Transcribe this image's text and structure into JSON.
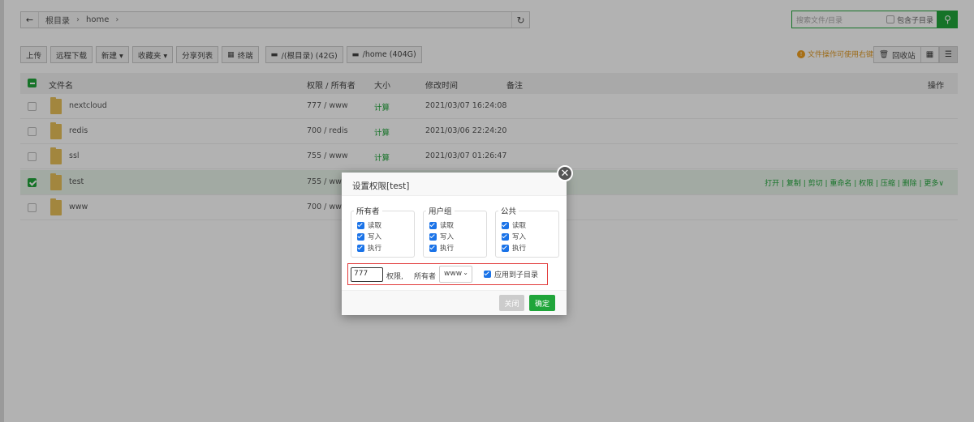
{
  "pathbar": {
    "back_icon": "arrow-left-icon",
    "crumbs": [
      "根目录",
      "home"
    ],
    "separator": "›",
    "refresh_icon": "refresh-icon"
  },
  "search": {
    "placeholder": "搜索文件/目录",
    "include_subdir_label": "包含子目录",
    "search_icon": "search-icon"
  },
  "toolbar": {
    "buttons": [
      "上传",
      "远程下载",
      "新建 ▾",
      "收藏夹 ▾",
      "分享列表",
      "终端"
    ],
    "disks": [
      "/(根目录) (42G)",
      "/home (404G)"
    ],
    "tip": "文件操作可使用右键",
    "recycle_label": "回收站"
  },
  "table": {
    "headers": {
      "name": "文件名",
      "perm": "权限 / 所有者",
      "size": "大小",
      "mtime": "修改时间",
      "note": "备注",
      "ops": "操作"
    },
    "rows": [
      {
        "name": "nextcloud",
        "perm": "777 / www",
        "size": "计算",
        "mtime": "2021/03/07 16:24:08",
        "selected": false
      },
      {
        "name": "redis",
        "perm": "700 / redis",
        "size": "计算",
        "mtime": "2021/03/06 22:24:20",
        "selected": false
      },
      {
        "name": "ssl",
        "perm": "755 / www",
        "size": "计算",
        "mtime": "2021/03/07 01:26:47",
        "selected": false
      },
      {
        "name": "test",
        "perm": "755 / www",
        "size": "",
        "mtime": "",
        "selected": true,
        "ops": "打开 | 复制 | 剪切 | 重命名 | 权限 | 压缩 | 删除 | 更多∨"
      },
      {
        "name": "www",
        "perm": "700 / www",
        "size": "",
        "mtime": "",
        "selected": false
      }
    ]
  },
  "modal": {
    "title": "设置权限[test]",
    "groups": [
      {
        "title": "所有者",
        "items": [
          "读取",
          "写入",
          "执行"
        ]
      },
      {
        "title": "用户组",
        "items": [
          "读取",
          "写入",
          "执行"
        ]
      },
      {
        "title": "公共",
        "items": [
          "读取",
          "写入",
          "执行"
        ]
      }
    ],
    "perm_value": "777",
    "perm_label": "权限,",
    "owner_label": "所有者",
    "owner_value": "www",
    "apply_sub_label": "应用到子目录",
    "close_label": "关闭",
    "ok_label": "确定"
  },
  "colors": {
    "accent": "#20a53a",
    "checkbox": "#1a73e8",
    "highlight_box": "#e23b3b",
    "tip": "#e09a25"
  }
}
